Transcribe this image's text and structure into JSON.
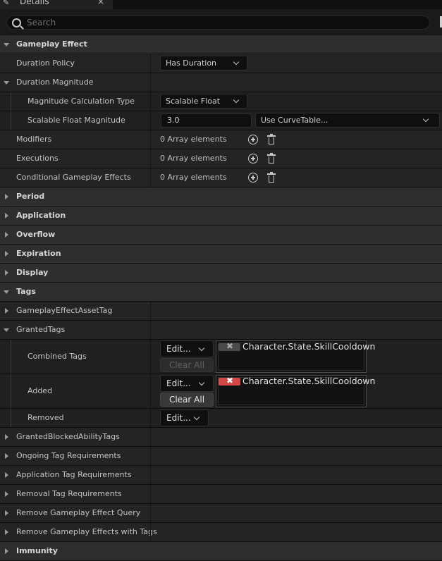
{
  "panel": {
    "title": "Details",
    "close_glyph": "×"
  },
  "search": {
    "placeholder": "Search"
  },
  "sections": {
    "gameplay_effect": "Gameplay Effect",
    "period": "Period",
    "application": "Application",
    "overflow": "Overflow",
    "expiration": "Expiration",
    "display": "Display",
    "tags": "Tags",
    "immunity": "Immunity"
  },
  "props": {
    "duration_policy": {
      "label": "Duration Policy",
      "value": "Has Duration"
    },
    "duration_magnitude": {
      "label": "Duration Magnitude"
    },
    "magnitude_calc_type": {
      "label": "Magnitude Calculation Type",
      "value": "Scalable Float"
    },
    "scalable_float_magnitude": {
      "label": "Scalable Float Magnitude",
      "value": "3.0",
      "curve": "Use CurveTable..."
    },
    "modifiers": {
      "label": "Modifiers",
      "value": "0 Array elements"
    },
    "executions": {
      "label": "Executions",
      "value": "0 Array elements"
    },
    "conditional_effects": {
      "label": "Conditional Gameplay Effects",
      "value": "0 Array elements"
    }
  },
  "tags": {
    "asset_tag": "GameplayEffectAssetTag",
    "granted_tags": "GrantedTags",
    "combined": {
      "label": "Combined Tags",
      "edit": "Edit...",
      "clear": "Clear All",
      "tag": "Character.State.SkillCooldown"
    },
    "added": {
      "label": "Added",
      "edit": "Edit...",
      "clear": "Clear All",
      "tag": "Character.State.SkillCooldown"
    },
    "removed": {
      "label": "Removed",
      "edit": "Edit..."
    },
    "granted_blocked": "GrantedBlockedAbilityTags",
    "ongoing_req": "Ongoing Tag Requirements",
    "application_req": "Application Tag Requirements",
    "removal_req": "Removal Tag Requirements",
    "remove_query": "Remove Gameplay Effect Query",
    "remove_with_tags": "Remove Gameplay Effects with Tags"
  },
  "colors": {
    "remove_tag_active": "#d24848",
    "remove_tag_inactive": "#4a4a4a"
  }
}
